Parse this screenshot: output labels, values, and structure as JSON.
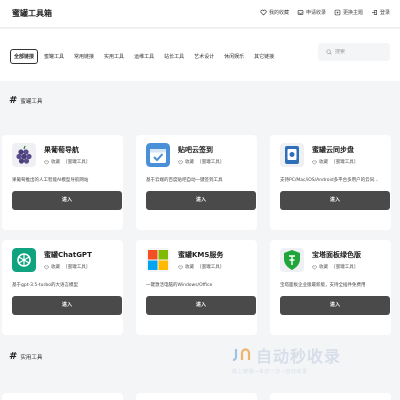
{
  "header": {
    "site_title": "蜜罐工具箱",
    "actions": [
      {
        "label": "我的收藏",
        "icon": "heart-icon"
      },
      {
        "label": "申请收录",
        "icon": "inbox-icon"
      },
      {
        "label": "更换主题",
        "icon": "palette-icon"
      },
      {
        "label": "登录",
        "icon": "login-icon"
      }
    ]
  },
  "nav": {
    "tabs": [
      "全部链接",
      "蜜罐工具",
      "常用链接",
      "实用工具",
      "运维工具",
      "站长工具",
      "艺术设计",
      "休闲娱乐",
      "其它链接"
    ],
    "active_tab": 0,
    "search_placeholder": "搜索"
  },
  "sections": [
    {
      "title": "蜜罐工具"
    },
    {
      "title": "实用工具"
    }
  ],
  "cards": [
    {
      "title": "果葡萄导航",
      "favorite": "收藏",
      "tag": "[蜜罐工具]",
      "desc": "果葡萄推出的人工智能AI模型导航网站",
      "enter": "进入",
      "icon": "grape-icon"
    },
    {
      "title": "贴吧云签到",
      "favorite": "收藏",
      "tag": "[蜜罐工具]",
      "desc": "基于云端的百度贴吧自动一键签到工具",
      "enter": "进入",
      "icon": "checkin-icon"
    },
    {
      "title": "蜜罐云同步盘",
      "favorite": "收藏",
      "tag": "[蜜罐工具]",
      "desc": "支持PC/Mac/iOS/Android多平台多用户的云同...",
      "enter": "进入",
      "icon": "cloud-drive-icon"
    },
    {
      "title": "蜜罐ChatGPT",
      "favorite": "收藏",
      "tag": "[蜜罐工具]",
      "desc": "基于gpt-3.5-turbo的大语言模型",
      "enter": "进入",
      "icon": "chatgpt-icon"
    },
    {
      "title": "蜜罐KMS服务",
      "favorite": "收藏",
      "tag": "[蜜罐工具]",
      "desc": "一键激活电脑的Windows/Office",
      "enter": "进入",
      "icon": "windows-icon"
    },
    {
      "title": "宝塔面板绿色版",
      "favorite": "收藏",
      "tag": "[蜜罐工具]",
      "desc": "宝塔面板企业版最新版，支持全插件免费用",
      "enter": "进入",
      "icon": "bt-panel-icon"
    }
  ],
  "watermark": {
    "main": "自动秒收录",
    "sub": "做上链接→来访一次→自动收录"
  }
}
